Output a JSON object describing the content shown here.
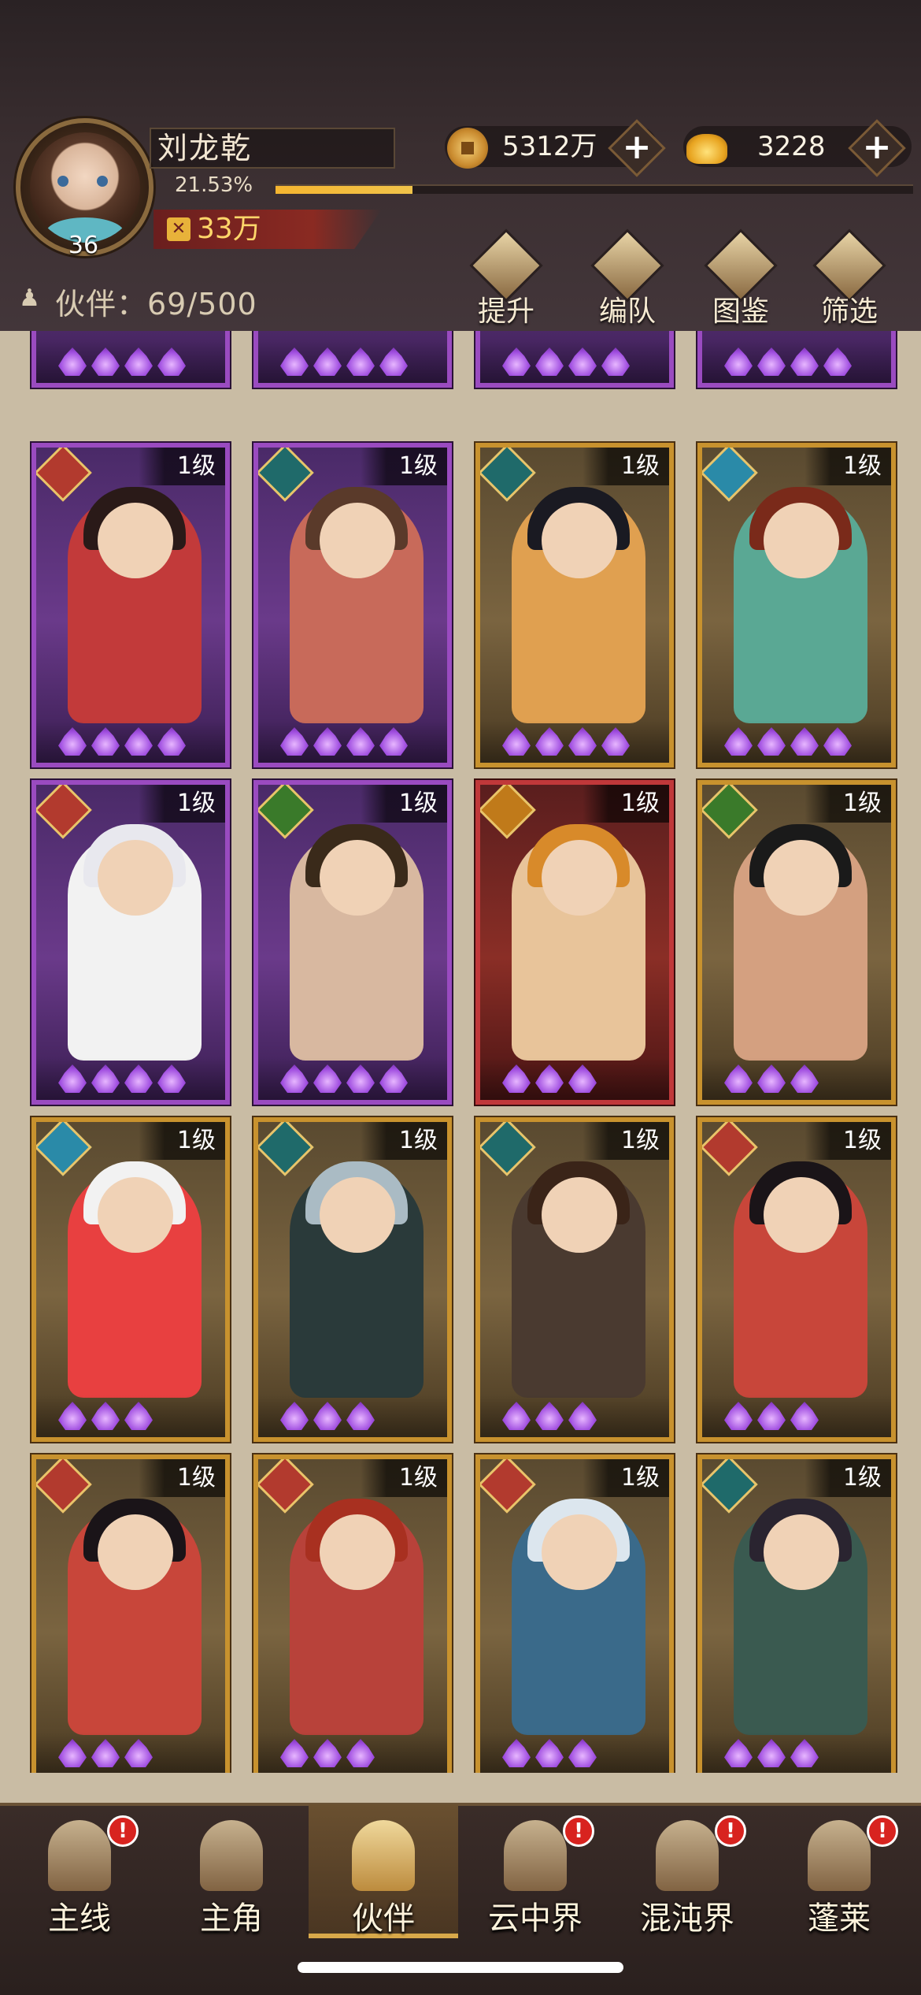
{
  "player": {
    "name": "刘龙乾",
    "level": "36",
    "exp_percent_text": "21.53%",
    "exp_fraction": 0.2153,
    "power": "33万",
    "power_icon": "crossed-swords-icon"
  },
  "currency": {
    "copper": "5312万",
    "gold": "3228",
    "add_label": "+"
  },
  "partners": {
    "count_text": "伙伴：69/500"
  },
  "actions": [
    {
      "label": "提升",
      "icon": "upgrade-icon"
    },
    {
      "label": "编队",
      "icon": "formation-flag-icon"
    },
    {
      "label": "图鉴",
      "icon": "scroll-icon"
    },
    {
      "label": "筛选",
      "icon": "filter-icon"
    }
  ],
  "cards": [
    {
      "level": "1级",
      "rarity": "purple",
      "faction": "fox",
      "stars": 4
    },
    {
      "level": "1级",
      "rarity": "purple",
      "faction": "beast",
      "stars": 4
    },
    {
      "level": "1级",
      "rarity": "gold",
      "faction": "beast",
      "stars": 4
    },
    {
      "level": "1级",
      "rarity": "gold",
      "faction": "bird",
      "stars": 4
    },
    {
      "level": "1级",
      "rarity": "purple",
      "faction": "fox",
      "stars": 4
    },
    {
      "level": "1级",
      "rarity": "purple",
      "faction": "leaf",
      "stars": 4
    },
    {
      "level": "1级",
      "rarity": "red",
      "faction": "flame",
      "stars": 3
    },
    {
      "level": "1级",
      "rarity": "gold",
      "faction": "leaf",
      "stars": 3
    },
    {
      "level": "1级",
      "rarity": "gold",
      "faction": "bird",
      "stars": 3
    },
    {
      "level": "1级",
      "rarity": "gold",
      "faction": "beast",
      "stars": 3
    },
    {
      "level": "1级",
      "rarity": "gold",
      "faction": "beast",
      "stars": 3
    },
    {
      "level": "1级",
      "rarity": "gold",
      "faction": "fox",
      "stars": 3
    },
    {
      "level": "1级",
      "rarity": "gold",
      "faction": "fox",
      "stars": 3
    },
    {
      "level": "1级",
      "rarity": "gold",
      "faction": "fox",
      "stars": 3
    },
    {
      "level": "1级",
      "rarity": "gold",
      "faction": "fox",
      "stars": 3
    },
    {
      "level": "1级",
      "rarity": "gold",
      "faction": "beast",
      "stars": 3
    }
  ],
  "partial_cards": [
    {
      "rarity": "purple",
      "stars": 4
    },
    {
      "rarity": "purple",
      "stars": 4
    },
    {
      "rarity": "purple",
      "stars": 4
    },
    {
      "rarity": "purple",
      "stars": 4
    }
  ],
  "nav": [
    {
      "label": "主线",
      "icon": "main-quest-icon",
      "alert": "!",
      "active": false
    },
    {
      "label": "主角",
      "icon": "hero-icon",
      "alert": "",
      "active": false
    },
    {
      "label": "伙伴",
      "icon": "partner-crown-icon",
      "alert": "",
      "active": true
    },
    {
      "label": "云中界",
      "icon": "cloud-realm-icon",
      "alert": "!",
      "active": false
    },
    {
      "label": "混沌界",
      "icon": "chaos-realm-icon",
      "alert": "!",
      "active": false
    },
    {
      "label": "蓬莱",
      "icon": "penglai-icon",
      "alert": "!",
      "active": false
    }
  ],
  "colors": {
    "accent_gold": "#c8922e",
    "rarity_purple": "#9a4bc0",
    "rarity_red": "#c0383a",
    "exp_fill": "#f5b530",
    "alert_red": "#d8231f"
  }
}
